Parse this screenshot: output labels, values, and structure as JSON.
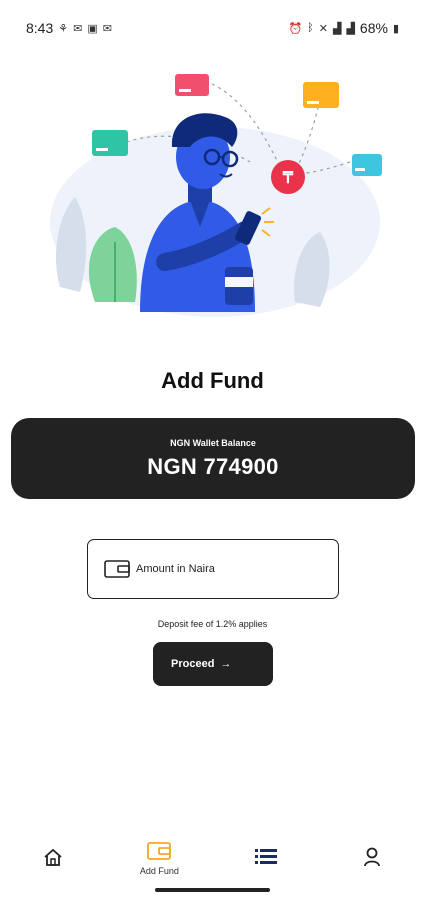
{
  "status_bar": {
    "time": "8:43",
    "battery": "68%",
    "icons_left": [
      "notification-icon",
      "mail-icon",
      "image-icon",
      "mail-icon"
    ],
    "icons_right": [
      "alarm-icon",
      "bluetooth-icon",
      "mute-icon",
      "lte-signal-icon",
      "signal-icon",
      "battery-icon"
    ]
  },
  "page": {
    "title": "Add Fund"
  },
  "wallet": {
    "label": "NGN Wallet Balance",
    "balance": "NGN 774900"
  },
  "amount_input": {
    "placeholder": "Amount in Naira",
    "value": ""
  },
  "fee_note": "Deposit fee of 1.2% applies",
  "proceed_button": {
    "label": "Proceed",
    "arrow": "→"
  },
  "bottom_nav": {
    "items": [
      {
        "icon": "home-icon",
        "label": ""
      },
      {
        "icon": "wallet-icon",
        "label": "Add Fund",
        "active": true
      },
      {
        "icon": "list-icon",
        "label": ""
      },
      {
        "icon": "user-icon",
        "label": ""
      }
    ]
  },
  "colors": {
    "card_background": "#222222",
    "active_nav": "#F5A623",
    "illustration_primary": "#2F5BE7"
  }
}
